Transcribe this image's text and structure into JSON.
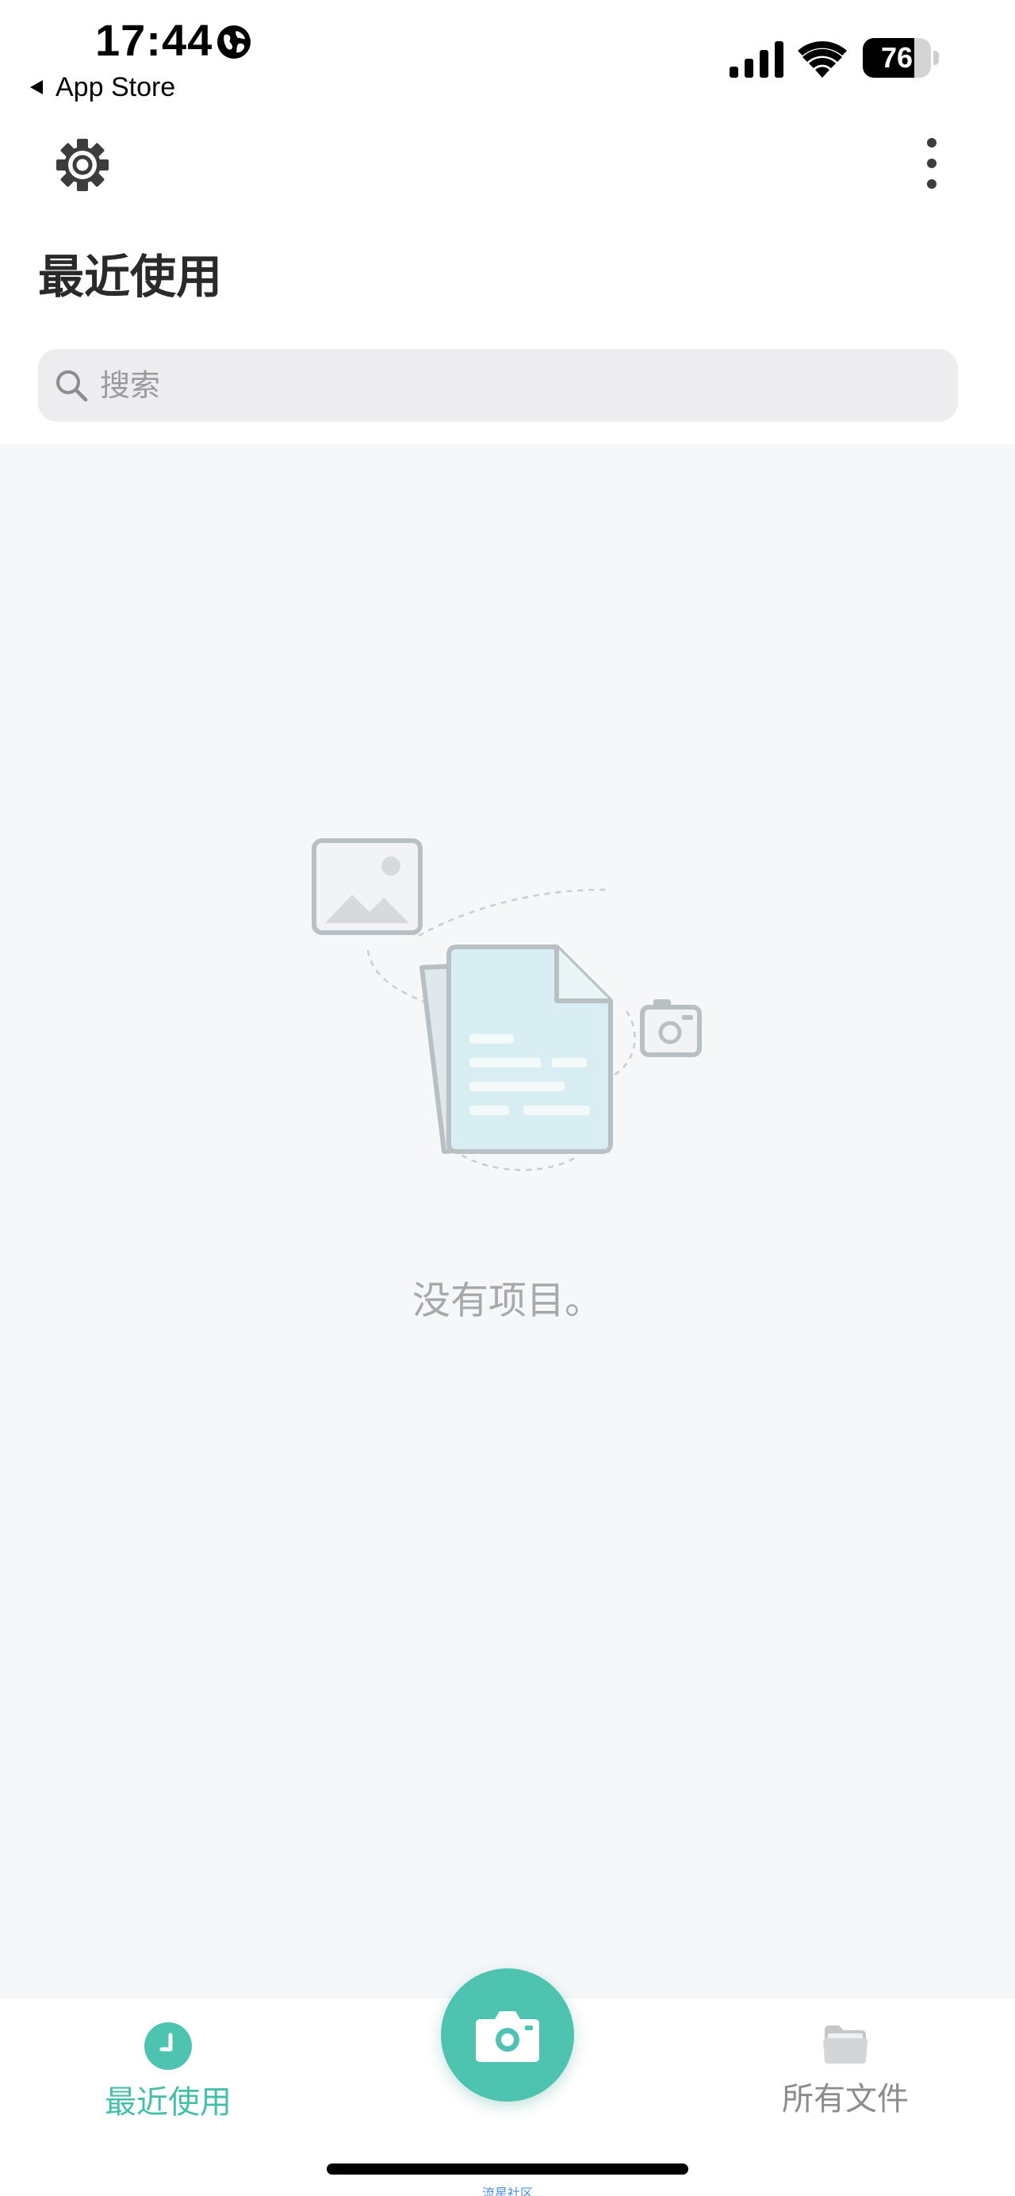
{
  "status_bar": {
    "time": "17:44",
    "back_label": "App Store",
    "battery_level": "76",
    "battery_fraction": 0.76
  },
  "toolbar": {
    "settings_icon": "gear-icon",
    "more_icon": "more-vertical-icon"
  },
  "page": {
    "title": "最近使用"
  },
  "search": {
    "placeholder": "搜索",
    "value": ""
  },
  "empty_state": {
    "message": "没有项目。",
    "illustration_icon": "documents-illustration"
  },
  "tabbar": {
    "recent_label": "最近使用",
    "files_label": "所有文件",
    "camera_icon": "camera-icon"
  },
  "watermark": "流星社区",
  "colors": {
    "accent": "#4dc3b0",
    "accent_text": "#45bfa9",
    "inactive_text": "#8a8c8f",
    "content_bg": "#f6f7f9",
    "title_text": "#2a2a2a"
  }
}
